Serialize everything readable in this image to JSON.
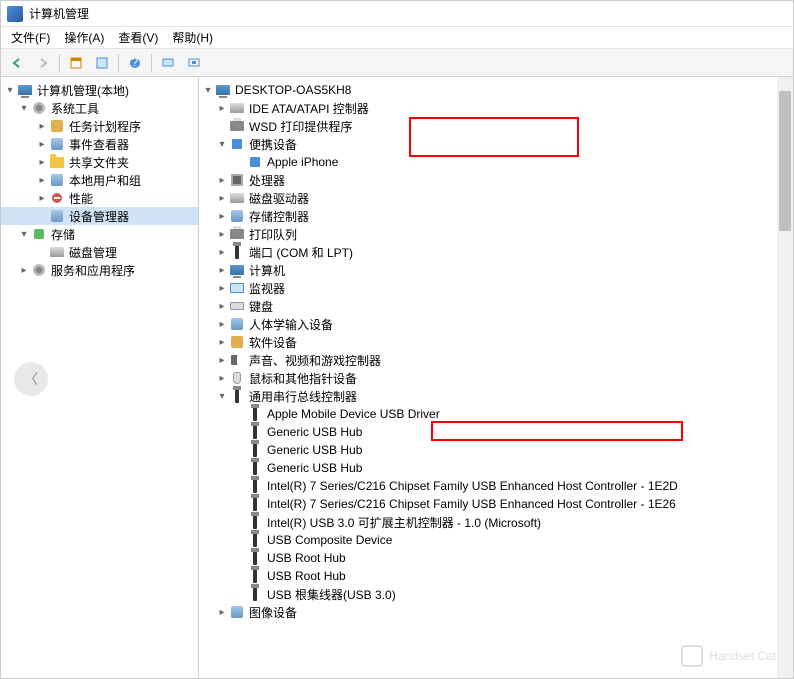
{
  "title": "计算机管理",
  "menu": {
    "file": "文件(F)",
    "action": "操作(A)",
    "view": "查看(V)",
    "help": "帮助(H)"
  },
  "left_tree": {
    "root": "计算机管理(本地)",
    "system_tools": "系统工具",
    "task_scheduler": "任务计划程序",
    "event_viewer": "事件查看器",
    "shared_folders": "共享文件夹",
    "local_users": "本地用户和组",
    "performance": "性能",
    "device_manager": "设备管理器",
    "storage": "存储",
    "disk_mgmt": "磁盘管理",
    "services": "服务和应用程序"
  },
  "right_tree": {
    "root": "DESKTOP-OAS5KH8",
    "ide": "IDE ATA/ATAPI 控制器",
    "wsd": "WSD 打印提供程序",
    "portable": "便携设备",
    "iphone": "Apple iPhone",
    "cpu": "处理器",
    "disk_drives": "磁盘驱动器",
    "storage_ctrl": "存储控制器",
    "print_queue": "打印队列",
    "ports": "端口 (COM 和 LPT)",
    "computer": "计算机",
    "monitor": "监视器",
    "keyboard": "键盘",
    "hid": "人体学输入设备",
    "software_dev": "软件设备",
    "sound": "声音、视频和游戏控制器",
    "mouse": "鼠标和其他指针设备",
    "usb_ctrl": "通用串行总线控制器",
    "usb_items": [
      "Apple Mobile Device USB Driver",
      "Generic USB Hub",
      "Generic USB Hub",
      "Generic USB Hub",
      "Intel(R) 7 Series/C216 Chipset Family USB Enhanced Host Controller - 1E2D",
      "Intel(R) 7 Series/C216 Chipset Family USB Enhanced Host Controller - 1E26",
      "Intel(R) USB 3.0 可扩展主机控制器 - 1.0 (Microsoft)",
      "USB Composite Device",
      "USB Root Hub",
      "USB Root Hub",
      "USB 根集线器(USB 3.0)"
    ],
    "image_dev": "图像设备"
  },
  "watermark": "Handset Cat"
}
